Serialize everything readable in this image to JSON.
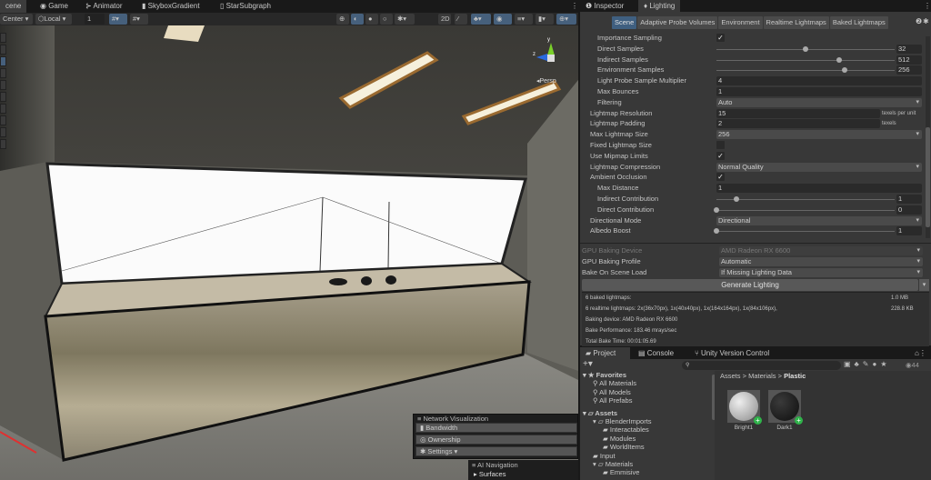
{
  "editor_tabs": [
    {
      "label": "cene",
      "icon": "scene-icon"
    },
    {
      "label": "Game",
      "icon": "gamepad-icon"
    },
    {
      "label": "Animator",
      "icon": "animator-icon"
    },
    {
      "label": "SkyboxGradient",
      "icon": "shader-icon"
    },
    {
      "label": "StarSubgraph",
      "icon": "subgraph-icon"
    }
  ],
  "scene_toolbar": {
    "pivot": "Center",
    "space": "Local",
    "grid_value": "1"
  },
  "scene": {
    "gizmo_y": "y",
    "gizmo_z": "z",
    "projection": "Persp"
  },
  "right_tabs": [
    {
      "label": "Inspector",
      "icon": "info-icon"
    },
    {
      "label": "Lighting",
      "icon": "lightbulb-icon"
    }
  ],
  "lighting_tabs": [
    "Scene",
    "Adaptive Probe Volumes",
    "Environment",
    "Realtime Lightmaps",
    "Baked Lightmaps"
  ],
  "lighting_rows": [
    {
      "label": "Importance Sampling",
      "indent": 1,
      "type": "check",
      "value": "✓"
    },
    {
      "label": "Direct Samples",
      "indent": 1,
      "type": "slider",
      "value": "32",
      "fraction": 0.5
    },
    {
      "label": "Indirect Samples",
      "indent": 1,
      "type": "slider",
      "value": "512",
      "fraction": 0.69
    },
    {
      "label": "Environment Samples",
      "indent": 1,
      "type": "slider",
      "value": "256",
      "fraction": 0.72
    },
    {
      "label": "Light Probe Sample Multiplier",
      "indent": 1,
      "type": "field",
      "value": "4"
    },
    {
      "label": "Max Bounces",
      "indent": 1,
      "type": "field",
      "value": "1"
    },
    {
      "label": "Filtering",
      "indent": 1,
      "type": "drop",
      "value": "Auto"
    },
    {
      "label": "Lightmap Resolution",
      "indent": 0,
      "type": "unitfield",
      "value": "15",
      "unit": "texels per unit"
    },
    {
      "label": "Lightmap Padding",
      "indent": 0,
      "type": "unitfield",
      "value": "2",
      "unit": "texels"
    },
    {
      "label": "Max Lightmap Size",
      "indent": 0,
      "type": "drop",
      "value": "256"
    },
    {
      "label": "Fixed Lightmap Size",
      "indent": 0,
      "type": "check",
      "value": ""
    },
    {
      "label": "Use Mipmap Limits",
      "indent": 0,
      "type": "check",
      "value": "✓"
    },
    {
      "label": "Lightmap Compression",
      "indent": 0,
      "type": "drop",
      "value": "Normal Quality"
    },
    {
      "label": "Ambient Occlusion",
      "indent": 0,
      "type": "check",
      "value": "✓"
    },
    {
      "label": "Max Distance",
      "indent": 1,
      "type": "field",
      "value": "1"
    },
    {
      "label": "Indirect Contribution",
      "indent": 1,
      "type": "slider",
      "value": "1",
      "fraction": 0.11
    },
    {
      "label": "Direct Contribution",
      "indent": 1,
      "type": "slider",
      "value": "0",
      "fraction": 0
    },
    {
      "label": "Directional Mode",
      "indent": 0,
      "type": "drop",
      "value": "Directional"
    },
    {
      "label": "Albedo Boost",
      "indent": 0,
      "type": "slider",
      "value": "1",
      "fraction": 0
    }
  ],
  "bake": {
    "gpu_device_label": "GPU Baking Device",
    "gpu_device_value": "AMD Radeon RX 6600",
    "gpu_profile_label": "GPU Baking Profile",
    "gpu_profile_value": "Automatic",
    "bake_on_load_label": "Bake On Scene Load",
    "bake_on_load_value": "If Missing Lighting Data",
    "generate_label": "Generate Lighting"
  },
  "bake_info": [
    {
      "text": "6 baked lightmaps:",
      "size": "1.0 MB"
    },
    {
      "text": "6 realtime lightmaps: 2x(36x70px), 1x(40x40px), 1x(164x164px), 1x(84x106px),",
      "size": "228.8 KB"
    },
    {
      "text": "Baking device: AMD Radeon RX 6600",
      "size": ""
    },
    {
      "text": "Bake Performance: 183.46 mrays/sec",
      "size": ""
    },
    {
      "text": "Total Bake Time: 00:01:05.69",
      "size": ""
    }
  ],
  "project_tabs": [
    {
      "label": "Project"
    },
    {
      "label": "Console"
    },
    {
      "label": "Unity Version Control"
    }
  ],
  "project": {
    "search_placeholder": "",
    "visible_count": "44",
    "breadcrumb": [
      "Assets",
      "Materials",
      "Plastic"
    ],
    "tree": [
      {
        "label": "Favorites",
        "level": 0,
        "type": "star"
      },
      {
        "label": "All Materials",
        "level": 1,
        "type": "search"
      },
      {
        "label": "All Models",
        "level": 1,
        "type": "search"
      },
      {
        "label": "All Prefabs",
        "level": 1,
        "type": "search"
      },
      {
        "label": "Assets",
        "level": 0,
        "type": "folder-open"
      },
      {
        "label": "BlenderImports",
        "level": 1,
        "type": "folder-open"
      },
      {
        "label": "Interactables",
        "level": 2,
        "type": "folder"
      },
      {
        "label": "Modules",
        "level": 2,
        "type": "folder"
      },
      {
        "label": "WorldItems",
        "level": 2,
        "type": "folder"
      },
      {
        "label": "Input",
        "level": 1,
        "type": "folder"
      },
      {
        "label": "Materials",
        "level": 1,
        "type": "folder-open"
      },
      {
        "label": "Emmisive",
        "level": 2,
        "type": "folder"
      }
    ],
    "assets": [
      {
        "name": "Bright1",
        "color": "#c8c8c8"
      },
      {
        "name": "Dark1",
        "color": "#161616"
      }
    ]
  },
  "overlays": {
    "network_title": "Network Visualization",
    "bandwidth": "Bandwidth",
    "ownership": "Ownership",
    "settings": "Settings ▾",
    "ai_title": "AI Navigation",
    "surfaces": "Surfaces"
  },
  "colors": {
    "accent": "#3f5f80",
    "panel": "#383838",
    "add_badge": "#2fb34a"
  }
}
